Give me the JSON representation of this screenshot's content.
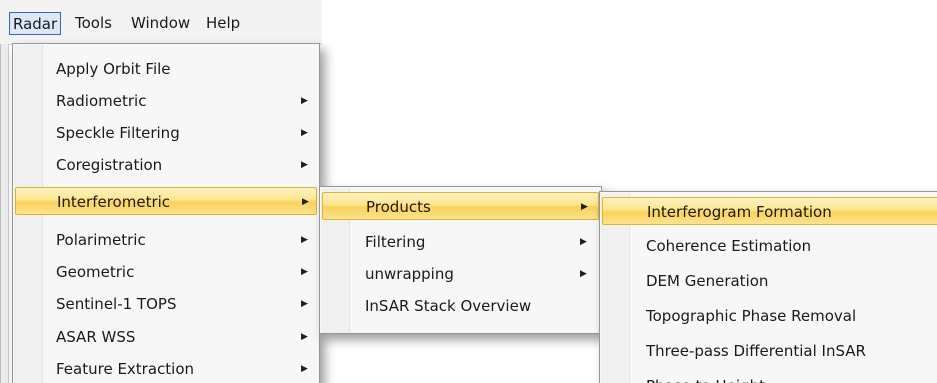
{
  "menubar": {
    "items": [
      {
        "label": "Radar"
      },
      {
        "label": "Tools"
      },
      {
        "label": "Window"
      },
      {
        "label": "Help"
      }
    ]
  },
  "radar_menu": {
    "items": [
      {
        "label": "Apply Orbit File",
        "has_submenu": false
      },
      {
        "label": "Radiometric",
        "has_submenu": true
      },
      {
        "label": "Speckle Filtering",
        "has_submenu": true
      },
      {
        "label": "Coregistration",
        "has_submenu": true
      },
      {
        "label": "Interferometric",
        "has_submenu": true,
        "highlighted": true
      },
      {
        "label": "Polarimetric",
        "has_submenu": true
      },
      {
        "label": "Geometric",
        "has_submenu": true
      },
      {
        "label": "Sentinel-1 TOPS",
        "has_submenu": true
      },
      {
        "label": "ASAR WSS",
        "has_submenu": true
      },
      {
        "label": "Feature Extraction",
        "has_submenu": true
      }
    ]
  },
  "interferometric_menu": {
    "items": [
      {
        "label": "Products",
        "has_submenu": true,
        "highlighted": true
      },
      {
        "label": "Filtering",
        "has_submenu": true
      },
      {
        "label": "unwrapping",
        "has_submenu": true
      },
      {
        "label": "InSAR Stack Overview",
        "has_submenu": false
      }
    ]
  },
  "products_menu": {
    "items": [
      {
        "label": "Interferogram Formation",
        "highlighted": true
      },
      {
        "label": "Coherence Estimation"
      },
      {
        "label": "DEM Generation"
      },
      {
        "label": "Topographic Phase Removal"
      },
      {
        "label": "Three-pass Differential InSAR"
      },
      {
        "label": "Phase to Height"
      }
    ]
  },
  "icons": {
    "submenu_arrow": "▶"
  },
  "colors": {
    "highlight_border": "#e3b22b",
    "highlight_fill": "#fde58e",
    "menubar_active": "#dce7f7"
  }
}
